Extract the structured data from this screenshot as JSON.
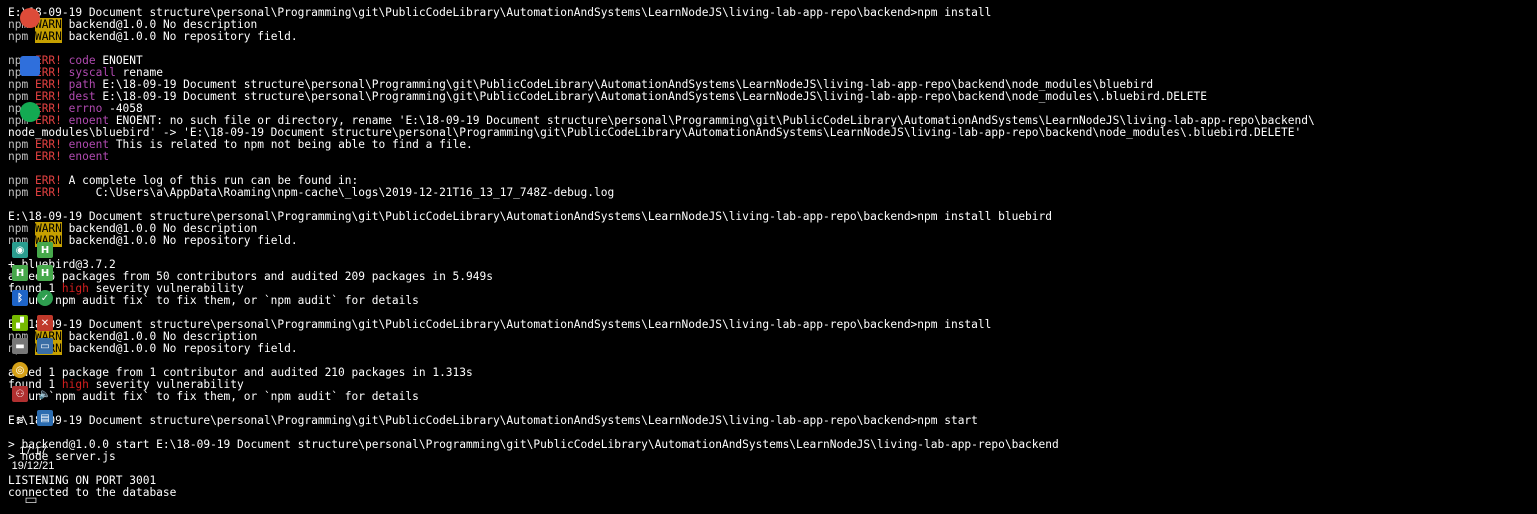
{
  "lines": [
    {
      "segs": [
        {
          "t": "E:\\18-09-19 Document structure\\personal\\Programming\\git\\PublicCodeLibrary\\AutomationAndSystems\\LearnNodeJS\\living-lab-app-repo\\backend>npm install",
          "c": "white"
        }
      ]
    },
    {
      "segs": [
        {
          "t": "npm ",
          "c": "gray"
        },
        {
          "t": "WARN",
          "c": "warn"
        },
        {
          "t": " backend@1.0.0 No description",
          "c": "white"
        }
      ]
    },
    {
      "segs": [
        {
          "t": "npm ",
          "c": "gray"
        },
        {
          "t": "WARN",
          "c": "warn"
        },
        {
          "t": " backend@1.0.0 No repository field.",
          "c": "white"
        }
      ]
    },
    {
      "segs": [
        {
          "t": "",
          "c": "gray"
        }
      ]
    },
    {
      "segs": [
        {
          "t": "npm ",
          "c": "gray"
        },
        {
          "t": "ERR!",
          "c": "err"
        },
        {
          "t": " ",
          "c": "gray"
        },
        {
          "t": "code",
          "c": "magenta"
        },
        {
          "t": " ENOENT",
          "c": "white"
        }
      ]
    },
    {
      "segs": [
        {
          "t": "npm ",
          "c": "gray"
        },
        {
          "t": "ERR!",
          "c": "err"
        },
        {
          "t": " ",
          "c": "gray"
        },
        {
          "t": "syscall",
          "c": "magenta"
        },
        {
          "t": " rename",
          "c": "white"
        }
      ]
    },
    {
      "segs": [
        {
          "t": "npm ",
          "c": "gray"
        },
        {
          "t": "ERR!",
          "c": "err"
        },
        {
          "t": " ",
          "c": "gray"
        },
        {
          "t": "path",
          "c": "magenta"
        },
        {
          "t": " E:\\18-09-19 Document structure\\personal\\Programming\\git\\PublicCodeLibrary\\AutomationAndSystems\\LearnNodeJS\\living-lab-app-repo\\backend\\node_modules\\bluebird",
          "c": "white"
        }
      ]
    },
    {
      "segs": [
        {
          "t": "npm ",
          "c": "gray"
        },
        {
          "t": "ERR!",
          "c": "err"
        },
        {
          "t": " ",
          "c": "gray"
        },
        {
          "t": "dest",
          "c": "magenta"
        },
        {
          "t": " E:\\18-09-19 Document structure\\personal\\Programming\\git\\PublicCodeLibrary\\AutomationAndSystems\\LearnNodeJS\\living-lab-app-repo\\backend\\node_modules\\.bluebird.DELETE",
          "c": "white"
        }
      ]
    },
    {
      "segs": [
        {
          "t": "npm ",
          "c": "gray"
        },
        {
          "t": "ERR!",
          "c": "err"
        },
        {
          "t": " ",
          "c": "gray"
        },
        {
          "t": "errno",
          "c": "magenta"
        },
        {
          "t": " -4058",
          "c": "white"
        }
      ]
    },
    {
      "segs": [
        {
          "t": "npm ",
          "c": "gray"
        },
        {
          "t": "ERR!",
          "c": "err"
        },
        {
          "t": " ",
          "c": "gray"
        },
        {
          "t": "enoent",
          "c": "magenta"
        },
        {
          "t": " ENOENT: no such file or directory, rename 'E:\\18-09-19 Document structure\\personal\\Programming\\git\\PublicCodeLibrary\\AutomationAndSystems\\LearnNodeJS\\living-lab-app-repo\\backend\\",
          "c": "white"
        }
      ]
    },
    {
      "segs": [
        {
          "t": "node_modules\\bluebird' -> 'E:\\18-09-19 Document structure\\personal\\Programming\\git\\PublicCodeLibrary\\AutomationAndSystems\\LearnNodeJS\\living-lab-app-repo\\backend\\node_modules\\.bluebird.DELETE'",
          "c": "white"
        }
      ]
    },
    {
      "segs": [
        {
          "t": "npm ",
          "c": "gray"
        },
        {
          "t": "ERR!",
          "c": "err"
        },
        {
          "t": " ",
          "c": "gray"
        },
        {
          "t": "enoent",
          "c": "magenta"
        },
        {
          "t": " This is related to npm not being able to find a file.",
          "c": "white"
        }
      ]
    },
    {
      "segs": [
        {
          "t": "npm ",
          "c": "gray"
        },
        {
          "t": "ERR!",
          "c": "err"
        },
        {
          "t": " ",
          "c": "gray"
        },
        {
          "t": "enoent",
          "c": "magenta"
        }
      ]
    },
    {
      "segs": [
        {
          "t": "",
          "c": "gray"
        }
      ]
    },
    {
      "segs": [
        {
          "t": "npm ",
          "c": "gray"
        },
        {
          "t": "ERR!",
          "c": "err"
        },
        {
          "t": " A complete log of this run can be found in:",
          "c": "white"
        }
      ]
    },
    {
      "segs": [
        {
          "t": "npm ",
          "c": "gray"
        },
        {
          "t": "ERR!",
          "c": "err"
        },
        {
          "t": "     C:\\Users\\a\\AppData\\Roaming\\npm-cache\\_logs\\2019-12-21T16_13_17_748Z-debug.log",
          "c": "white"
        }
      ]
    },
    {
      "segs": [
        {
          "t": "",
          "c": "gray"
        }
      ]
    },
    {
      "segs": [
        {
          "t": "E:\\18-09-19 Document structure\\personal\\Programming\\git\\PublicCodeLibrary\\AutomationAndSystems\\LearnNodeJS\\living-lab-app-repo\\backend>npm install bluebird",
          "c": "white"
        }
      ]
    },
    {
      "segs": [
        {
          "t": "npm ",
          "c": "gray"
        },
        {
          "t": "WARN",
          "c": "warn"
        },
        {
          "t": " backend@1.0.0 No description",
          "c": "white"
        }
      ]
    },
    {
      "segs": [
        {
          "t": "npm ",
          "c": "gray"
        },
        {
          "t": "WARN",
          "c": "warn"
        },
        {
          "t": " backend@1.0.0 No repository field.",
          "c": "white"
        }
      ]
    },
    {
      "segs": [
        {
          "t": "",
          "c": "gray"
        }
      ]
    },
    {
      "segs": [
        {
          "t": "+ bluebird@3.7.2",
          "c": "white"
        }
      ]
    },
    {
      "segs": [
        {
          "t": "added 6 packages from 50 contributors and audited 209 packages in 5.949s",
          "c": "white"
        }
      ]
    },
    {
      "segs": [
        {
          "t": "found 1 ",
          "c": "white"
        },
        {
          "t": "high",
          "c": "red"
        },
        {
          "t": " severity vulnerability",
          "c": "white"
        }
      ]
    },
    {
      "segs": [
        {
          "t": "  run `npm audit fix` to fix them, or `npm audit` for details",
          "c": "white"
        }
      ]
    },
    {
      "segs": [
        {
          "t": "",
          "c": "gray"
        }
      ]
    },
    {
      "segs": [
        {
          "t": "E:\\18-09-19 Document structure\\personal\\Programming\\git\\PublicCodeLibrary\\AutomationAndSystems\\LearnNodeJS\\living-lab-app-repo\\backend>npm install",
          "c": "white"
        }
      ]
    },
    {
      "segs": [
        {
          "t": "npm ",
          "c": "gray"
        },
        {
          "t": "WARN",
          "c": "warn"
        },
        {
          "t": " backend@1.0.0 No description",
          "c": "white"
        }
      ]
    },
    {
      "segs": [
        {
          "t": "npm ",
          "c": "gray"
        },
        {
          "t": "WARN",
          "c": "warn"
        },
        {
          "t": " backend@1.0.0 No repository field.",
          "c": "white"
        }
      ]
    },
    {
      "segs": [
        {
          "t": "",
          "c": "gray"
        }
      ]
    },
    {
      "segs": [
        {
          "t": "added 1 package from 1 contributor and audited 210 packages in 1.313s",
          "c": "white"
        }
      ]
    },
    {
      "segs": [
        {
          "t": "found 1 ",
          "c": "white"
        },
        {
          "t": "high",
          "c": "red"
        },
        {
          "t": " severity vulnerability",
          "c": "white"
        }
      ]
    },
    {
      "segs": [
        {
          "t": "  run `npm audit fix` to fix them, or `npm audit` for details",
          "c": "white"
        }
      ]
    },
    {
      "segs": [
        {
          "t": "",
          "c": "gray"
        }
      ]
    },
    {
      "segs": [
        {
          "t": "E:\\18-09-19 Document structure\\personal\\Programming\\git\\PublicCodeLibrary\\AutomationAndSystems\\LearnNodeJS\\living-lab-app-repo\\backend>npm start",
          "c": "white"
        }
      ]
    },
    {
      "segs": [
        {
          "t": "",
          "c": "gray"
        }
      ]
    },
    {
      "segs": [
        {
          "t": "> backend@1.0.0 start E:\\18-09-19 Document structure\\personal\\Programming\\git\\PublicCodeLibrary\\AutomationAndSystems\\LearnNodeJS\\living-lab-app-repo\\backend",
          "c": "white"
        }
      ]
    },
    {
      "segs": [
        {
          "t": "> node server.js",
          "c": "white"
        }
      ]
    },
    {
      "segs": [
        {
          "t": "",
          "c": "gray"
        }
      ]
    },
    {
      "segs": [
        {
          "t": "LISTENING ON PORT 3001",
          "c": "white"
        }
      ]
    },
    {
      "segs": [
        {
          "t": "connected to the database",
          "c": "white"
        }
      ]
    }
  ],
  "taskbar": {
    "pinned": [
      {
        "name": "chrome-icon",
        "glyph": "",
        "bg": "#dd4b39"
      },
      {
        "name": "webstorm-icon",
        "glyph": "",
        "bg": "#2f6fdc"
      },
      {
        "name": "mongodb-compass-icon",
        "glyph": "",
        "bg": "#13aa52"
      }
    ],
    "tray": [
      {
        "name": "eye-icon",
        "glyph": "◉",
        "bg": "#2a9d8f"
      },
      {
        "name": "hc-icon-1",
        "glyph": "H",
        "bg": "#46a84b"
      },
      {
        "name": "hc-icon-2",
        "glyph": "H",
        "bg": "#46a84b"
      },
      {
        "name": "hc-icon-3",
        "glyph": "H",
        "bg": "#46a84b"
      },
      {
        "name": "bluetooth-icon",
        "glyph": "ᛒ",
        "bg": "#1e64c8"
      },
      {
        "name": "phone-link-icon",
        "glyph": "✓",
        "bg": "#2e9e4f"
      },
      {
        "name": "nvidia-icon",
        "glyph": "▞",
        "bg": "#76b900"
      },
      {
        "name": "security-alert-icon",
        "glyph": "✕",
        "bg": "#c0392b"
      },
      {
        "name": "drive-icon",
        "glyph": "▬",
        "bg": "#777777"
      },
      {
        "name": "monitor-icon",
        "glyph": "▭",
        "bg": "#3a6ea5"
      },
      {
        "name": "network-globe-icon",
        "glyph": "◎",
        "bg": "#d4a017"
      },
      {
        "name": "volume-icon",
        "glyph": "🔈",
        "bg": "#333333"
      },
      {
        "name": "people-icon",
        "glyph": "⚇",
        "bg": "#b03030"
      },
      {
        "name": "windows-icon",
        "glyph": "▤",
        "bg": "#2b6cb0"
      },
      {
        "name": "wifi-icon",
        "glyph": "≋",
        "bg": "#444444"
      },
      {
        "name": "language-icon",
        "glyph": "▦",
        "bg": "#555555"
      }
    ],
    "time": "17:17",
    "date": "19/12/21",
    "notification_glyph": "▭"
  }
}
